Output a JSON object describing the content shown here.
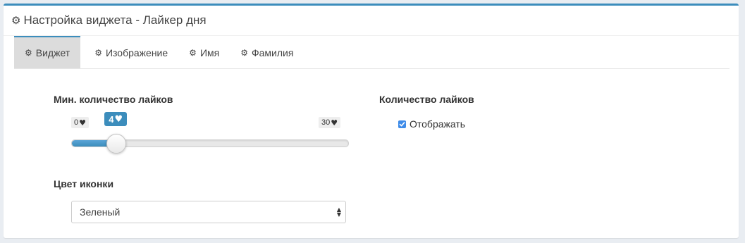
{
  "header": {
    "title": "Настройка виджета - Лайкер дня"
  },
  "tabs": [
    {
      "label": "Виджет",
      "active": true
    },
    {
      "label": "Изображение",
      "active": false
    },
    {
      "label": "Имя",
      "active": false
    },
    {
      "label": "Фамилия",
      "active": false
    }
  ],
  "min_likes": {
    "label": "Мин. количество лайков",
    "min": "0",
    "max": "30",
    "value": "4",
    "min_value": 0,
    "max_value": 30,
    "current_value": 4,
    "heart_icon": "♥"
  },
  "icon_color": {
    "label": "Цвет иконки",
    "selected": "Зеленый"
  },
  "likes_count": {
    "label": "Количество лайков",
    "checkbox_label": "Отображать",
    "checked": true
  },
  "icons": {
    "gear": "gear-icon",
    "heart": "heart-icon"
  },
  "colors": {
    "accent": "#3c8dbc",
    "checkbox": "#3f8ce9",
    "active_tab_bg": "#dcdcdc"
  }
}
